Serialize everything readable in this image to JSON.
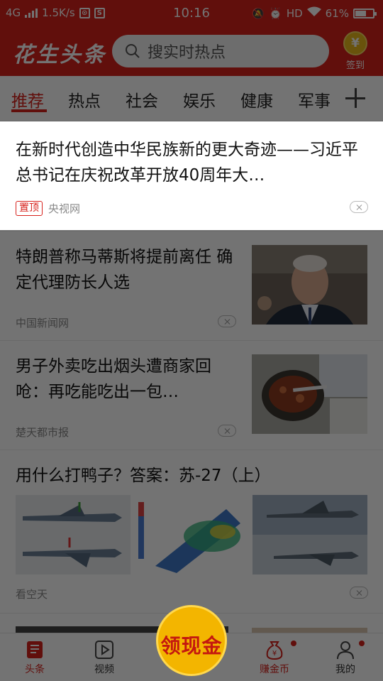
{
  "status_bar": {
    "network": "4G",
    "speed": "1.5K/s",
    "time": "10:16",
    "hd": "HD",
    "battery": "61%",
    "battery_level": 0.61
  },
  "header": {
    "brand": "花生头条",
    "search_placeholder": "搜实时热点",
    "signin_label": "签到",
    "coin_symbol": "¥"
  },
  "tabs": [
    "推荐",
    "热点",
    "社会",
    "娱乐",
    "健康",
    "军事"
  ],
  "feed": {
    "pinned": {
      "title": "在新时代创造中华民族新的更大奇迹——习近平总书记在庆祝改革开放40周年大…",
      "badge": "置顶",
      "source": "央视网"
    },
    "items": [
      {
        "title": "特朗普称马蒂斯将提前离任 确定代理防长人选",
        "source": "中国新闻网"
      },
      {
        "title": "男子外卖吃出烟头遭商家回呛：再吃能吃出一包…",
        "source": "楚天都市报"
      },
      {
        "title": "用什么打鸭子？答案：苏-27（上）",
        "source": "看空天"
      }
    ]
  },
  "bottom_nav": {
    "items": [
      "头条",
      "视频",
      "赚金币",
      "我的"
    ],
    "cash_label": "领现金"
  },
  "colors": {
    "accent": "#d7221c",
    "gold": "#f3b500"
  }
}
